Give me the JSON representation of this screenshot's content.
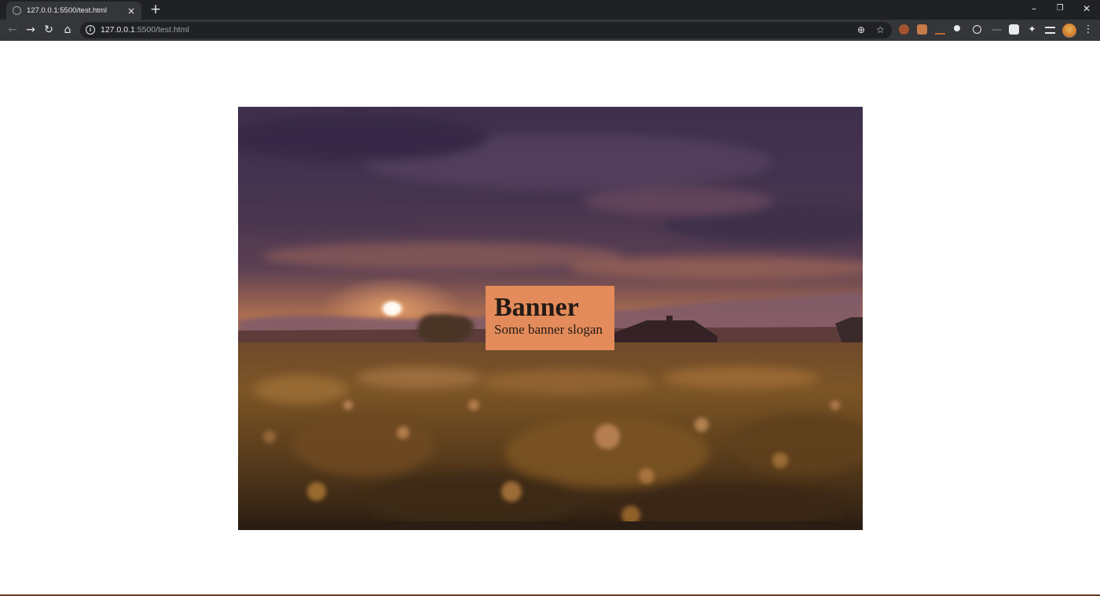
{
  "browser": {
    "tab_title": "127.0.0.1:5500/test.html",
    "close_glyph": "×",
    "new_tab_glyph": "+",
    "window_controls": {
      "minimize": "–",
      "maximize": "❐",
      "close": "✕"
    },
    "nav": {
      "back": "←",
      "forward": "→",
      "reload": "↻",
      "home": "⌂"
    },
    "url_host": "127.0.0.1",
    "url_rest": ":5500/test.html",
    "info_glyph": "i",
    "zoom_glyph": "⊕",
    "star_glyph": "☆",
    "menu_glyph": "⋮",
    "extensions": [
      "ublock-icon",
      "shield-icon",
      "chart-icon",
      "dot-icon",
      "react-icon",
      "dash-icon",
      "music-icon",
      "puzzle-icon",
      "reading-list-icon"
    ]
  },
  "page": {
    "banner_title": "Banner",
    "banner_slogan": "Some banner slogan",
    "banner_box_color": "#e38b5a"
  }
}
